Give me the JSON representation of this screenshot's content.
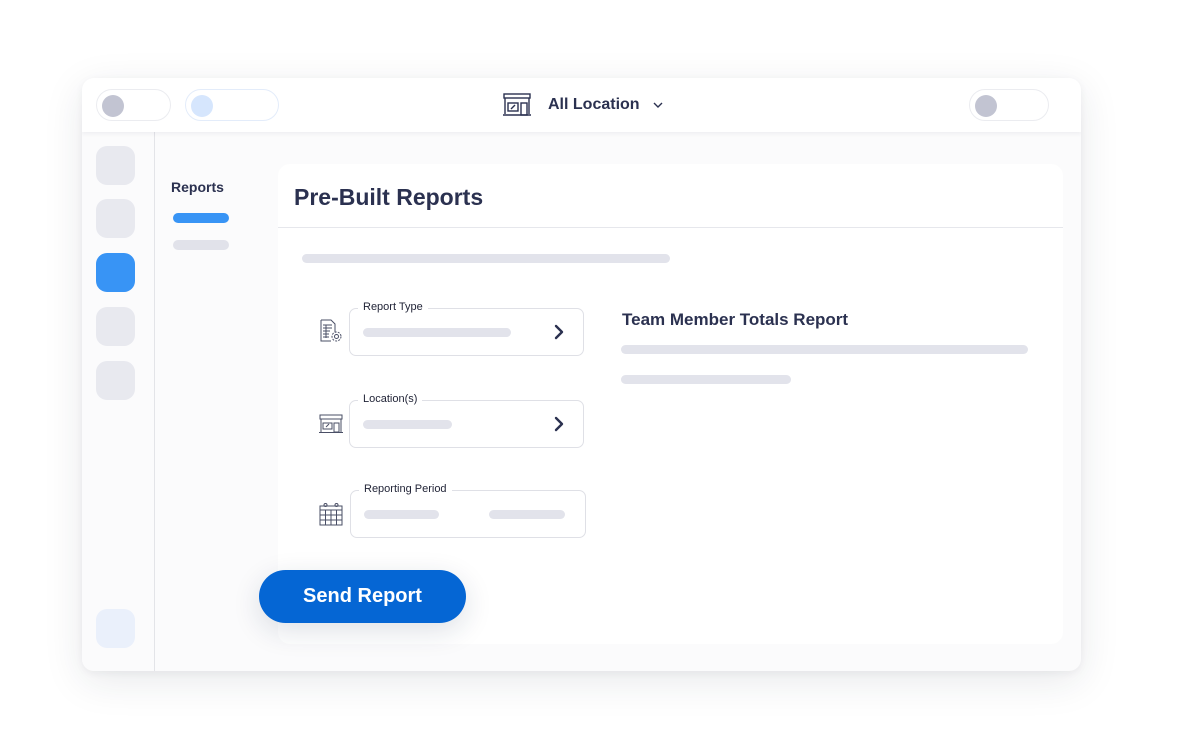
{
  "topbar": {
    "toggles": [
      {
        "name": "toggle-left-1",
        "state": "off"
      },
      {
        "name": "toggle-left-2",
        "state": "off"
      },
      {
        "name": "toggle-right",
        "state": "off"
      }
    ],
    "location_selector": {
      "icon": "storefront-icon",
      "label": "All Location",
      "dropdown_icon": "chevron-down-icon"
    }
  },
  "rail": {
    "items": [
      {
        "state": "idle"
      },
      {
        "state": "idle"
      },
      {
        "state": "active"
      },
      {
        "state": "idle"
      },
      {
        "state": "idle"
      }
    ],
    "bottom_item": {
      "state": "idle"
    }
  },
  "subnav": {
    "title": "Reports"
  },
  "card": {
    "title": "Pre-Built Reports",
    "fields": [
      {
        "label": "Report Type",
        "icon": "report-settings-icon",
        "action_icon": "chevron-right-icon"
      },
      {
        "label": "Location(s)",
        "icon": "storefront-icon",
        "action_icon": "chevron-right-icon"
      },
      {
        "label": "Reporting Period",
        "icon": "calendar-icon"
      }
    ],
    "preview": {
      "title": "Team Member Totals Report"
    }
  },
  "actions": {
    "send_label": "Send Report"
  },
  "colors": {
    "accent": "#3894f5",
    "primary_button": "#0566d4",
    "text_dark": "#2b3150",
    "skeleton": "#e2e3eb"
  }
}
